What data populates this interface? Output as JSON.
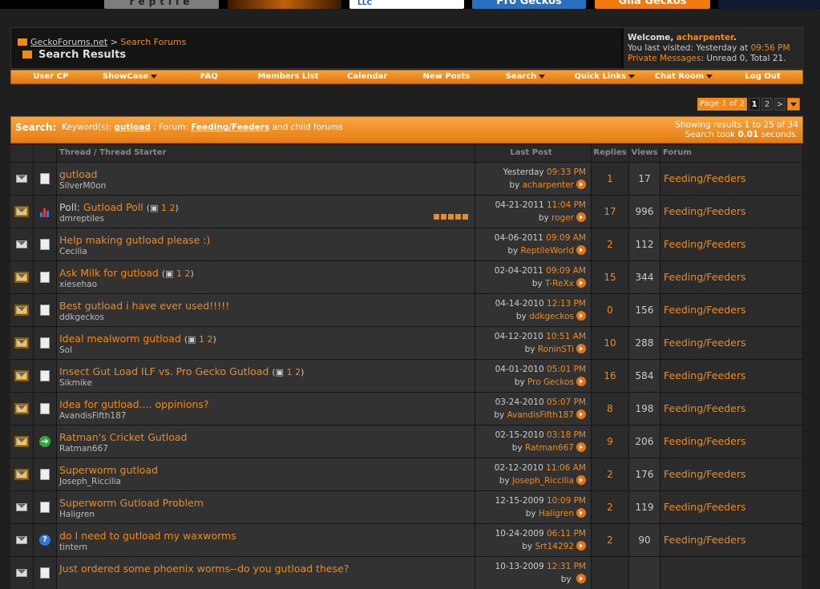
{
  "banner": {
    "ad1": "reptile",
    "ad3": "LLC",
    "ad4": "Pro Geckos",
    "ad5": "Gila Geckos",
    "ad6": ""
  },
  "breadcrumb": {
    "site": "GeckoForums.net",
    "separator": ">",
    "current": "Search Forums"
  },
  "page_title": "Search Results",
  "welcome": {
    "label": "Welcome,",
    "user": "acharpenter",
    "last_visited_label": "You last visited: Yesterday at",
    "last_visited_time": "09:56 PM",
    "pm_label": "Private Messages",
    "pm_value": ": Unread 0, Total 21."
  },
  "menu": [
    {
      "label": "User CP",
      "dropdown": false
    },
    {
      "label": "ShowCase",
      "dropdown": true
    },
    {
      "label": "FAQ",
      "dropdown": false
    },
    {
      "label": "Members List",
      "dropdown": false
    },
    {
      "label": "Calendar",
      "dropdown": false
    },
    {
      "label": "New Posts",
      "dropdown": false
    },
    {
      "label": "Search",
      "dropdown": true
    },
    {
      "label": "Quick Links",
      "dropdown": true
    },
    {
      "label": "Chat Room",
      "dropdown": true
    },
    {
      "label": "Log Out",
      "dropdown": false
    }
  ],
  "pager": {
    "caption": "Page 1 of 2",
    "current": "1",
    "next_page": "2",
    "next": ">"
  },
  "search": {
    "label": "Search:",
    "keyword_label": "Keyword(s):",
    "keyword": "gutload",
    "forum_label": "; Forum:",
    "forum": "Feeding/Feeders",
    "forum_suffix": "and child forums",
    "results": "Showing results 1 to 25 of 34",
    "took_prefix": "Search took",
    "took_value": "0.01",
    "took_suffix": "seconds."
  },
  "columns": {
    "thread": "Thread / Thread Starter",
    "last_post": "Last Post",
    "replies": "Replies",
    "views": "Views",
    "forum": "Forum"
  },
  "threads": [
    {
      "prefix": "",
      "title": "gutload",
      "pages": "",
      "starter": "SilverM0on",
      "date": "Yesterday",
      "time": "09:33 PM",
      "by": "acharpenter",
      "replies": "1",
      "views": "17",
      "forum": "Feeding/Feeders",
      "status_icon": "envelope-icon",
      "type_icon": "document-icon",
      "rating": false
    },
    {
      "prefix": "Poll:",
      "title": "Gutload Poll",
      "pages": "1 2",
      "starter": "dmreptiles",
      "date": "04-21-2011",
      "time": "11:04 PM",
      "by": "roger",
      "replies": "17",
      "views": "996",
      "forum": "Feeding/Feeders",
      "status_icon": "hot-envelope-icon",
      "type_icon": "poll-icon",
      "rating": true
    },
    {
      "prefix": "",
      "title": "Help making gutload please :)",
      "pages": "",
      "starter": "Cecilia",
      "date": "04-06-2011",
      "time": "09:09 AM",
      "by": "ReptileWorld",
      "replies": "2",
      "views": "112",
      "forum": "Feeding/Feeders",
      "status_icon": "envelope-icon",
      "type_icon": "document-icon",
      "rating": false
    },
    {
      "prefix": "",
      "title": "Ask Milk for gutload",
      "pages": "1 2",
      "starter": "xiesehao",
      "date": "02-04-2011",
      "time": "09:09 AM",
      "by": "T-ReXx",
      "replies": "15",
      "views": "344",
      "forum": "Feeding/Feeders",
      "status_icon": "hot-envelope-icon",
      "type_icon": "document-icon",
      "rating": false
    },
    {
      "prefix": "",
      "title": "Best gutload i have ever used!!!!!",
      "pages": "",
      "starter": "ddkgeckos",
      "date": "04-14-2010",
      "time": "12:13 PM",
      "by": "ddkgeckos",
      "replies": "0",
      "views": "156",
      "forum": "Feeding/Feeders",
      "status_icon": "hot-envelope-icon",
      "type_icon": "document-icon",
      "rating": false
    },
    {
      "prefix": "",
      "title": "Ideal mealworm gutload",
      "pages": "1 2",
      "starter": "Sol",
      "date": "04-12-2010",
      "time": "10:51 AM",
      "by": "RoninSTi",
      "replies": "10",
      "views": "288",
      "forum": "Feeding/Feeders",
      "status_icon": "hot-envelope-icon",
      "type_icon": "document-icon",
      "rating": false
    },
    {
      "prefix": "",
      "title": "Insect Gut Load ILF vs. Pro Gecko Gutload",
      "pages": "1 2",
      "starter": "Sikmike",
      "date": "04-01-2010",
      "time": "05:01 PM",
      "by": "Pro Geckos",
      "replies": "16",
      "views": "584",
      "forum": "Feeding/Feeders",
      "status_icon": "hot-envelope-icon",
      "type_icon": "document-icon",
      "rating": false
    },
    {
      "prefix": "",
      "title": "Idea for gutload.... oppinions?",
      "pages": "",
      "starter": "AvandisFifth187",
      "date": "03-24-2010",
      "time": "05:07 PM",
      "by": "AvandisFifth187",
      "replies": "8",
      "views": "198",
      "forum": "Feeding/Feeders",
      "status_icon": "hot-envelope-icon",
      "type_icon": "document-icon",
      "rating": false
    },
    {
      "prefix": "",
      "title": "Ratman's Cricket Gutload",
      "pages": "",
      "starter": "Ratman667",
      "date": "02-15-2010",
      "time": "03:18 PM",
      "by": "Ratman667",
      "replies": "9",
      "views": "206",
      "forum": "Feeding/Feeders",
      "status_icon": "hot-envelope-icon",
      "type_icon": "arrow-icon",
      "rating": false
    },
    {
      "prefix": "",
      "title": "Superworm gutload",
      "pages": "",
      "starter": "Joseph_Riccilia",
      "date": "02-12-2010",
      "time": "11:06 AM",
      "by": "Joseph_Riccilia",
      "replies": "2",
      "views": "176",
      "forum": "Feeding/Feeders",
      "status_icon": "hot-envelope-icon",
      "type_icon": "document-icon",
      "rating": false
    },
    {
      "prefix": "",
      "title": "Superworm Gutload Problem",
      "pages": "",
      "starter": "Haligren",
      "date": "12-15-2009",
      "time": "10:09 PM",
      "by": "Haligren",
      "replies": "2",
      "views": "119",
      "forum": "Feeding/Feeders",
      "status_icon": "envelope-icon",
      "type_icon": "document-icon",
      "rating": false
    },
    {
      "prefix": "",
      "title": "do I need to gutload my waxworms",
      "pages": "",
      "starter": "tintern",
      "date": "10-24-2009",
      "time": "06:11 PM",
      "by": "Srt14292",
      "replies": "2",
      "views": "90",
      "forum": "Feeding/Feeders",
      "status_icon": "envelope-icon",
      "type_icon": "question-icon",
      "rating": false
    },
    {
      "prefix": "",
      "title": "Just ordered some phoenix worms--do you gutload these?",
      "pages": "",
      "starter": "",
      "date": "10-13-2009",
      "time": "12:31 PM",
      "by": "",
      "replies": "",
      "views": "",
      "forum": "",
      "status_icon": "envelope-icon",
      "type_icon": "document-icon",
      "rating": false
    }
  ]
}
